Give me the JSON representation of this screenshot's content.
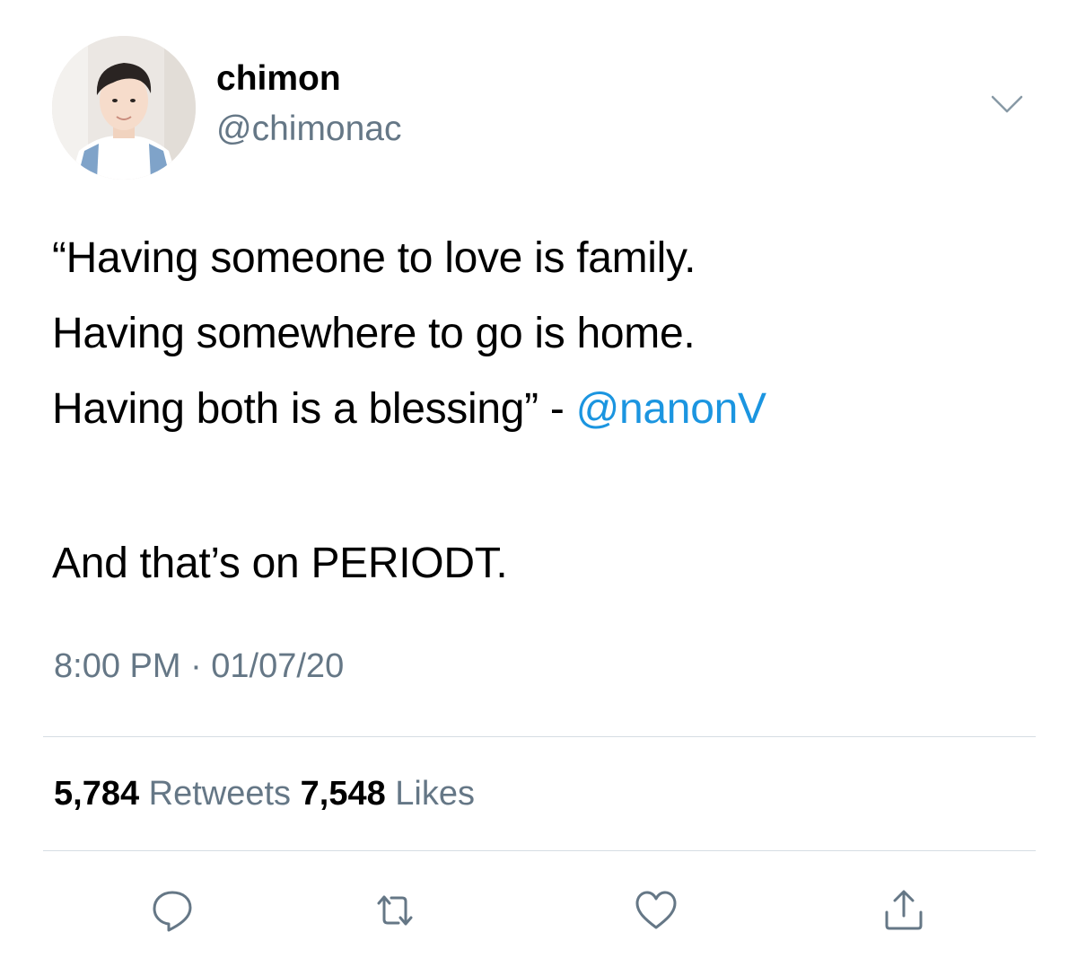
{
  "user": {
    "display_name": "chimon",
    "handle": "@chimonac"
  },
  "tweet": {
    "line1": "“Having someone to love is family.",
    "line2": "Having somewhere to go is home.",
    "line3_prefix": "Having both is a blessing” - ",
    "line3_mention": "@nanonV",
    "line4": "And that’s on PERIODT.",
    "timestamp": "8:00 PM · 01/07/20"
  },
  "stats": {
    "retweets_count": "5,784",
    "retweets_label": "Retweets",
    "likes_count": "7,548",
    "likes_label": "Likes"
  },
  "icons": {
    "caret": "chevron-down-icon",
    "reply": "reply-icon",
    "retweet": "retweet-icon",
    "like": "heart-icon",
    "share": "share-icon"
  },
  "colors": {
    "mention": "#1b95e0",
    "secondary_text": "#657786",
    "icon": "#657786",
    "divider": "#d6dde3"
  }
}
